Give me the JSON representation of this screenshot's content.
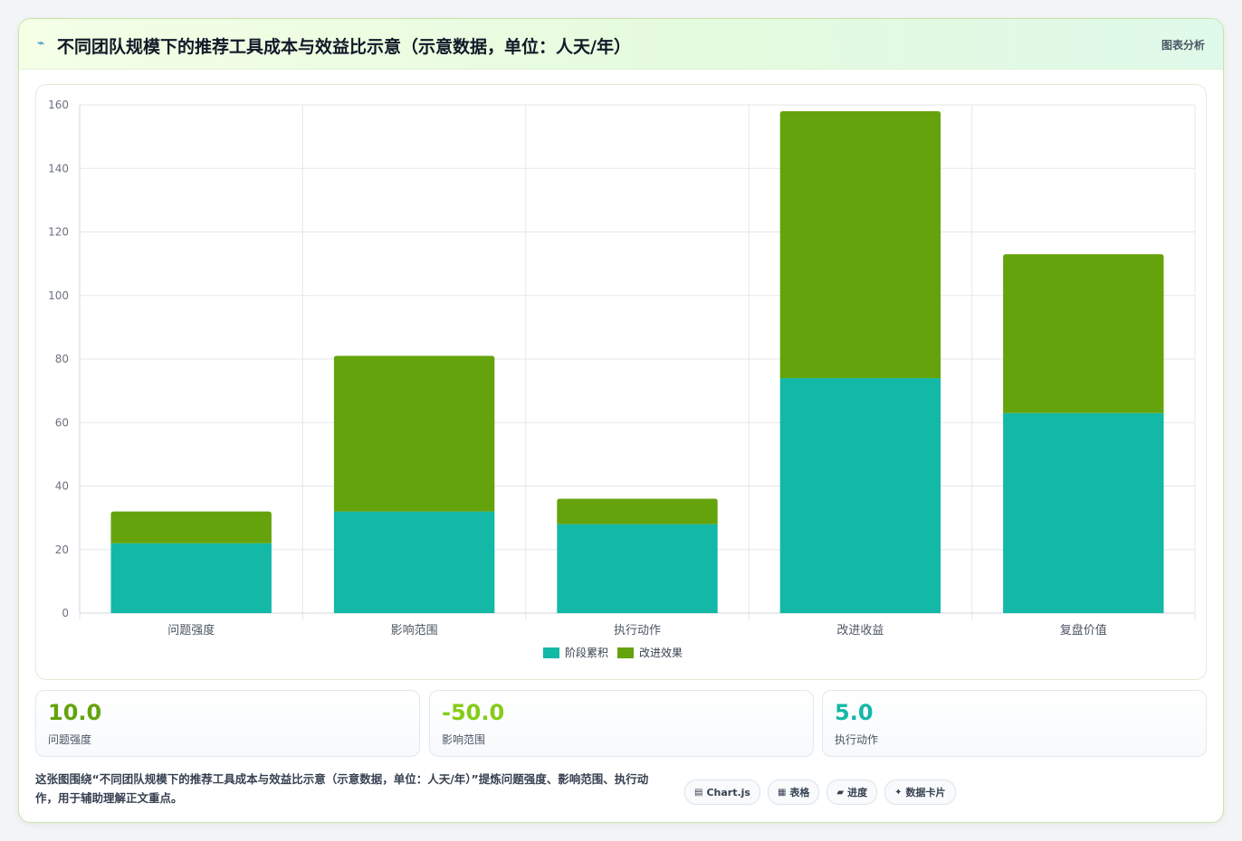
{
  "header": {
    "icon": "chart-line-icon",
    "icon_glyph": "⌁",
    "title": "不同团队规模下的推荐工具成本与效益比示意（示意数据，单位：人天/年）",
    "action_label": "图表分析"
  },
  "colors": {
    "series1": "#14b8a6",
    "series2": "#65a30d",
    "accent_green": "#65a30d",
    "accent_lime": "#84cc16",
    "accent_teal": "#14b8a6"
  },
  "chart_data": {
    "type": "bar",
    "stacked": true,
    "categories": [
      "问题强度",
      "影响范围",
      "执行动作",
      "改进收益",
      "复盘价值"
    ],
    "series": [
      {
        "name": "阶段累积",
        "values": [
          22,
          32,
          28,
          74,
          63
        ],
        "color": "#14b8a6"
      },
      {
        "name": "改进效果",
        "values": [
          10,
          49,
          8,
          84,
          50
        ],
        "color": "#65a30d"
      }
    ],
    "ylim": [
      0,
      160
    ],
    "yticks": [
      0,
      20,
      40,
      60,
      80,
      100,
      120,
      140,
      160
    ],
    "grid": true,
    "legend_position": "bottom"
  },
  "stats": [
    {
      "value": "10.0",
      "label": "问题强度",
      "color": "#65a30d"
    },
    {
      "value": "-50.0",
      "label": "影响范围",
      "color": "#84cc16"
    },
    {
      "value": "5.0",
      "label": "执行动作",
      "color": "#14b8a6"
    }
  ],
  "footer": {
    "description": "这张图围绕“不同团队规模下的推荐工具成本与效益比示意（示意数据，单位：人天/年）”提炼问题强度、影响范围、执行动作，用于辅助理解正文重点。",
    "chips": [
      {
        "icon": "chartjs-icon",
        "glyph": "▤",
        "label": "Chart.js"
      },
      {
        "icon": "table-icon",
        "glyph": "▦",
        "label": "表格"
      },
      {
        "icon": "progress-icon",
        "glyph": "▰",
        "label": "进度"
      },
      {
        "icon": "data-card-icon",
        "glyph": "✦",
        "label": "数据卡片"
      }
    ]
  }
}
